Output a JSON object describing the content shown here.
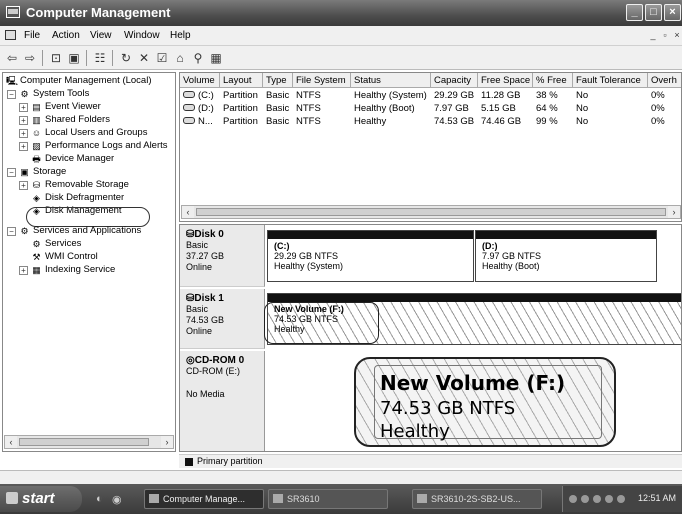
{
  "window": {
    "title": "Computer Management"
  },
  "menubar": {
    "items": [
      "File",
      "Action",
      "View",
      "Window",
      "Help"
    ],
    "mdi_controls": [
      "_",
      "▫",
      "×"
    ]
  },
  "toolbar": {
    "icons": [
      "back-icon",
      "forward-icon",
      "up-icon",
      "show-hide-tree-icon",
      "properties-icon",
      "refresh-icon",
      "delete-icon",
      "properties2-icon",
      "open-icon",
      "search-icon",
      "disk-icon"
    ]
  },
  "tree": {
    "items": [
      {
        "label": "Computer Management (Local)",
        "icon": "computer-icon"
      },
      {
        "label": "System Tools",
        "icon": "tools-icon"
      },
      {
        "label": "Event Viewer",
        "icon": "event-viewer-icon"
      },
      {
        "label": "Shared Folders",
        "icon": "shared-folders-icon"
      },
      {
        "label": "Local Users and Groups",
        "icon": "users-icon"
      },
      {
        "label": "Performance Logs and Alerts",
        "icon": "performance-icon"
      },
      {
        "label": "Device Manager",
        "icon": "device-manager-icon"
      },
      {
        "label": "Storage",
        "icon": "storage-icon"
      },
      {
        "label": "Removable Storage",
        "icon": "removable-storage-icon"
      },
      {
        "label": "Disk Defragmenter",
        "icon": "defragmenter-icon"
      },
      {
        "label": "Disk Management",
        "icon": "disk-management-icon"
      },
      {
        "label": "Services and Applications",
        "icon": "services-apps-icon"
      },
      {
        "label": "Services",
        "icon": "services-icon"
      },
      {
        "label": "WMI Control",
        "icon": "wmi-icon"
      },
      {
        "label": "Indexing Service",
        "icon": "indexing-icon"
      }
    ]
  },
  "volumes": {
    "columns": [
      "Volume",
      "Layout",
      "Type",
      "File System",
      "Status",
      "Capacity",
      "Free Space",
      "% Free",
      "Fault Tolerance",
      "Overh"
    ],
    "rows": [
      [
        "(C:)",
        "Partition",
        "Basic",
        "NTFS",
        "Healthy (System)",
        "29.29 GB",
        "11.28 GB",
        "38 %",
        "No",
        "0%"
      ],
      [
        "(D:)",
        "Partition",
        "Basic",
        "NTFS",
        "Healthy (Boot)",
        "7.97 GB",
        "5.15 GB",
        "64 %",
        "No",
        "0%"
      ],
      [
        "N...",
        "Partition",
        "Basic",
        "NTFS",
        "Healthy",
        "74.53 GB",
        "74.46 GB",
        "99 %",
        "No",
        "0%"
      ]
    ]
  },
  "disks": [
    {
      "name": "Disk 0",
      "type": "Basic",
      "size": "37.27 GB",
      "status": "Online",
      "partitions": [
        {
          "name": "(C:)",
          "size": "29.29 GB NTFS",
          "status": "Healthy (System)"
        },
        {
          "name": "(D:)",
          "size": "7.97 GB NTFS",
          "status": "Healthy (Boot)"
        }
      ]
    },
    {
      "name": "Disk 1",
      "type": "Basic",
      "size": "74.53 GB",
      "status": "Online",
      "partitions": [
        {
          "name": "New Volume  (F:)",
          "size": "74.53 GB NTFS",
          "status": "Healthy"
        }
      ]
    },
    {
      "name": "CD-ROM 0",
      "type": "CD-ROM (E:)",
      "size": "",
      "status": "No Media",
      "partitions": []
    }
  ],
  "callout": {
    "line1": "New Volume  (F:)",
    "line2": "74.53 GB NTFS",
    "line3": "Healthy"
  },
  "legend": {
    "label": "Primary partition"
  },
  "taskbar": {
    "start": "start",
    "tasks": [
      "Computer Manage...",
      "SR3610",
      "SR3610-2S-SB2-US..."
    ],
    "clock": "12:51 AM"
  }
}
